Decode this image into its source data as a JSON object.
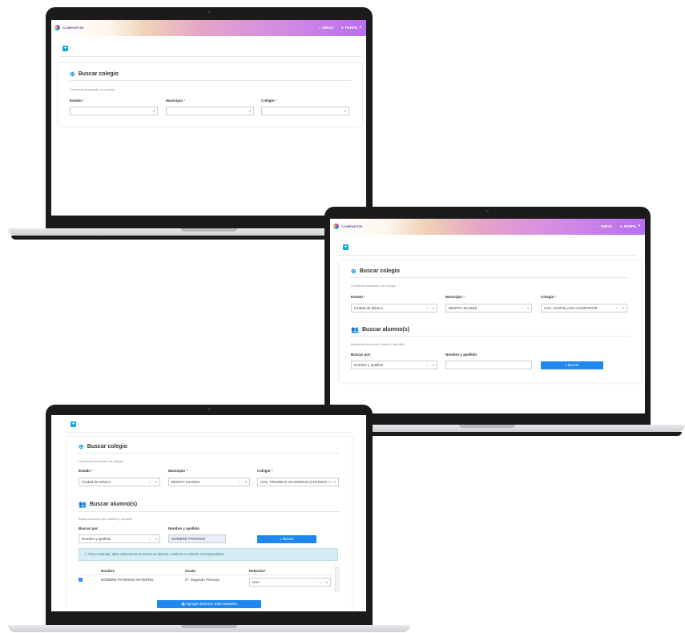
{
  "app": {
    "logo_text": "COMPARTIR"
  },
  "nav": {
    "home_label": "INICIO",
    "profile_label": "PERFIL"
  },
  "icons": {
    "home": "home-icon",
    "user": "user-icon",
    "plus": "plus-icon",
    "search": "search-icon",
    "users": "users-icon",
    "info": "info-icon",
    "check": "check-icon",
    "chevron": "chevron-down-icon",
    "clear": "clear-icon",
    "list": "list-icon"
  },
  "colors": {
    "accent": "#1e88f0",
    "brand_gradient_end": "#b86ef0",
    "plus_button": "#12a4de"
  },
  "school_search": {
    "title": "Buscar colegio",
    "subtitle": "Comienza buscando un colegio",
    "estado_label": "Estado",
    "municipio_label": "Municipio",
    "colegio_label": "Colegio",
    "required_mark": "*"
  },
  "screen1": {
    "estado_value": "",
    "municipio_value": "",
    "colegio_value": ""
  },
  "screen2": {
    "estado_value": "Ciudad de México",
    "municipio_value": "BENITO JUAREZ",
    "colegio_value": "COL. SANTILLANA COMPARTIR"
  },
  "screen3": {
    "estado_value": "Ciudad de México",
    "municipio_value": "BENITO JUAREZ",
    "colegio_value": "COL. PRUEBAS ACUERDOS (COLEGIO P..."
  },
  "student_search": {
    "title": "Buscar alumno(s)",
    "subtitle": "Busca alumnos por nombre y apellido",
    "search_by_label": "Buscar por:",
    "search_by_value": "Nombre y apellido",
    "name_label": "Nombre y apellido",
    "search_button": "Buscar",
    "name_value_screen3": "NOMBRE PATERNO"
  },
  "alert": {
    "text": "Para continuar, debe seleccionar al menos un alumno e indicar su relación correspondiente."
  },
  "results_table": {
    "headers": [
      "Nombre",
      "Grado",
      "Relación*"
    ],
    "rows": [
      {
        "nombre": "NOMBRE PATERNO MATERNO",
        "grado": "2º: Segundo Primaria",
        "relacion": "Otro"
      }
    ]
  },
  "add_button": {
    "label": "Agregar alumnos seleccionados"
  }
}
